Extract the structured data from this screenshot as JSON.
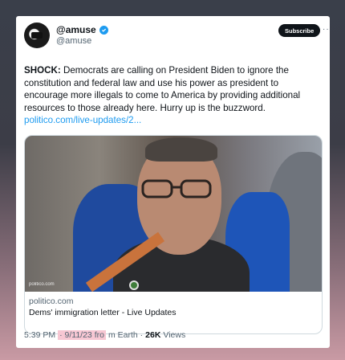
{
  "tweet": {
    "display_name": "@amuse",
    "handle": "@amuse",
    "avatar_icon": "stormtrooper-avatar",
    "verified_icon": "verified-badge-icon",
    "subscribe_label": "Subscribe",
    "more_label": "···",
    "text_bold": "SHOCK:",
    "text_body": " Democrats are calling on President Biden to ignore the constitution and federal law and use his power as president to encourage more illegals to come to America by providing additional resources to those already here. Hurry up is the buzzword.",
    "link": "politico.com/live-updates/2..."
  },
  "card": {
    "watermark": "politico.com",
    "domain": "politico.com",
    "title": "Dems' immigration letter - Live Updates"
  },
  "meta": {
    "time": "5:39 PM",
    "date": "· 9/11/23 fro",
    "from": "m Earth ·",
    "views_count": "26K",
    "views_label": "Views"
  },
  "colors": {
    "accent": "#1d9bf0",
    "text": "#0f1419",
    "muted": "#536471",
    "highlight": "#f7c7d3"
  }
}
